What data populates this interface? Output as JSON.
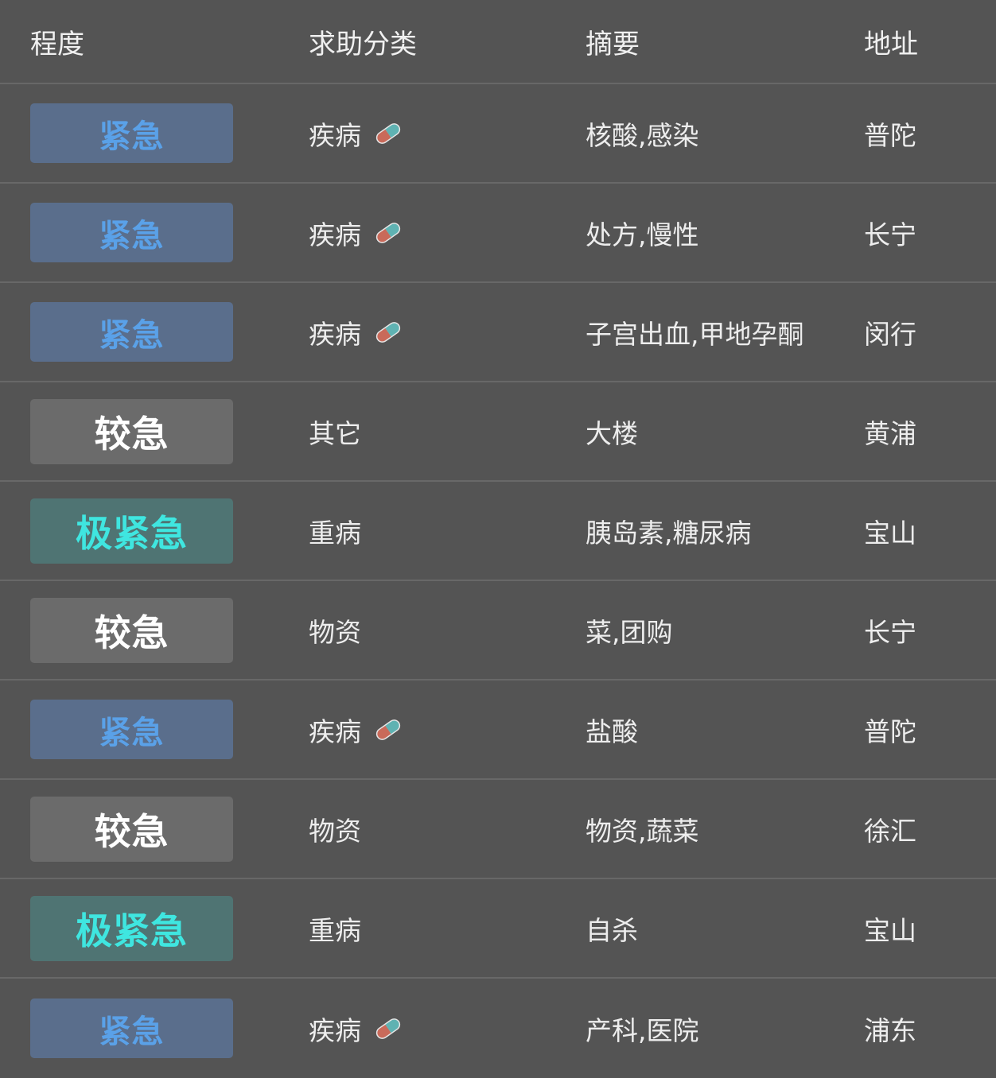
{
  "table": {
    "headers": [
      "程度",
      "求助分类",
      "摘要",
      "地址"
    ],
    "rows": [
      {
        "level": "紧急",
        "level_type": "urgent",
        "category": "疾病",
        "icon": "pill-icon",
        "summary": "核酸,感染",
        "address": "普陀"
      },
      {
        "level": "紧急",
        "level_type": "urgent",
        "category": "疾病",
        "icon": "pill-icon",
        "summary": "处方,慢性",
        "address": "长宁"
      },
      {
        "level": "紧急",
        "level_type": "urgent",
        "category": "疾病",
        "icon": "pill-icon",
        "summary": "子宫出血,甲地孕酮",
        "address": "闵行"
      },
      {
        "level": "较急",
        "level_type": "fairly",
        "category": "其它",
        "icon": "",
        "summary": "大楼",
        "address": "黄浦"
      },
      {
        "level": "极紧急",
        "level_type": "critical",
        "category": "重病",
        "icon": "",
        "summary": "胰岛素,糖尿病",
        "address": "宝山"
      },
      {
        "level": "较急",
        "level_type": "fairly",
        "category": "物资",
        "icon": "",
        "summary": "菜,团购",
        "address": "长宁"
      },
      {
        "level": "紧急",
        "level_type": "urgent",
        "category": "疾病",
        "icon": "pill-icon",
        "summary": "盐酸",
        "address": "普陀"
      },
      {
        "level": "较急",
        "level_type": "fairly",
        "category": "物资",
        "icon": "",
        "summary": "物资,蔬菜",
        "address": "徐汇"
      },
      {
        "level": "极紧急",
        "level_type": "critical",
        "category": "重病",
        "icon": "",
        "summary": "自杀",
        "address": "宝山"
      },
      {
        "level": "紧急",
        "level_type": "urgent",
        "category": "疾病",
        "icon": "pill-icon",
        "summary": "产科,医院",
        "address": "浦东"
      }
    ]
  },
  "colors": {
    "background": "#545454",
    "urgent_bg": "#5a6e8c",
    "urgent_text": "#5aa1e8",
    "fairly_bg": "#6b6b6b",
    "fairly_text": "#ffffff",
    "critical_bg": "#4f7473",
    "critical_text": "#3fe6e0"
  }
}
